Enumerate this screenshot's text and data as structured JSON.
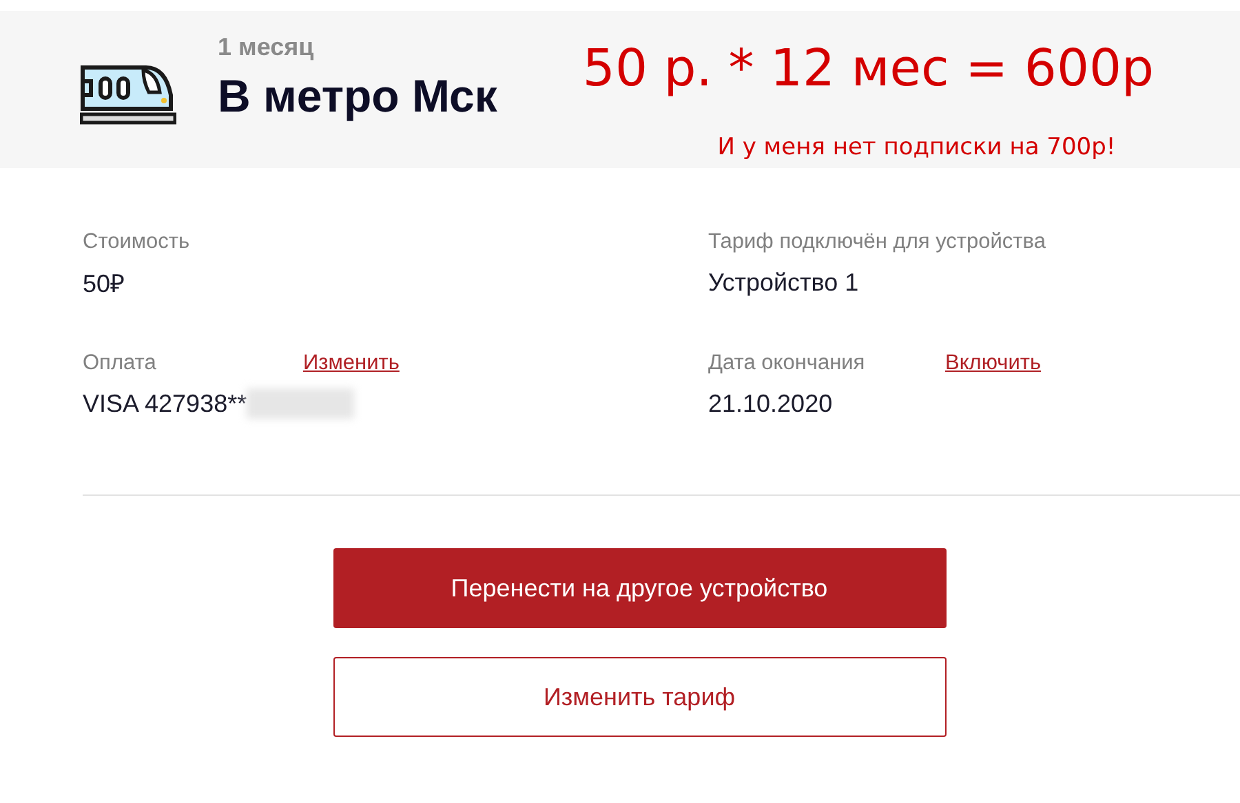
{
  "header": {
    "subtitle": "1 месяц",
    "title": "В метро Мск",
    "annotation": {
      "formula": "50 р. * 12 мес = 600р",
      "note": "И у меня нет подписки на 700р!"
    }
  },
  "fields": [
    {
      "label": "Стоимость",
      "value": "50₽",
      "redacted": false
    },
    {
      "label": "Тариф подключён для устройства",
      "value": "Устройство 1",
      "redacted": false
    },
    {
      "label": "Оплата",
      "value": "VISA 427938**",
      "action": "Изменить",
      "redacted": true
    },
    {
      "label": "Дата окончания",
      "value": "21.10.2020",
      "action": "Включить",
      "redacted": false
    }
  ],
  "buttons": [
    {
      "label": "Перенести на другое устройство",
      "kind": "primary"
    },
    {
      "label": "Изменить тариф",
      "kind": "secondary"
    }
  ]
}
